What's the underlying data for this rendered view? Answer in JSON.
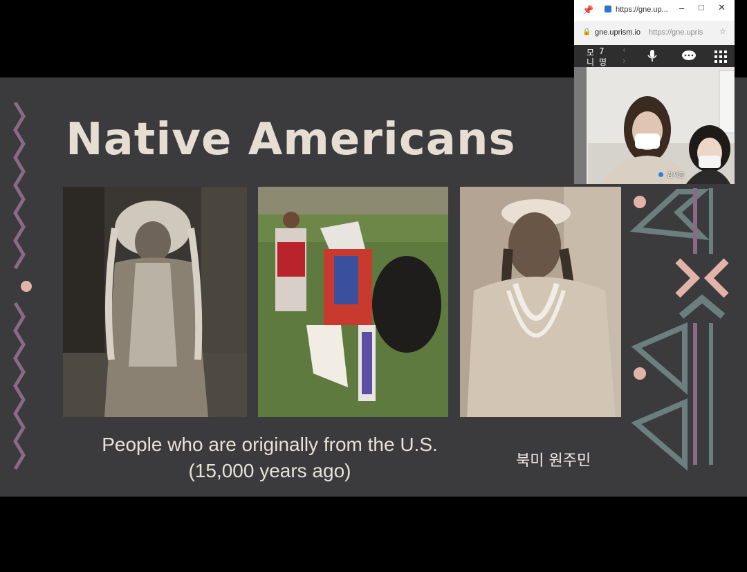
{
  "slide": {
    "title": "Native Americans",
    "caption_line1": "People who are originally from the U.S.",
    "caption_line2": "(15,000 years ago)",
    "handwritten_note": "북미 원주민"
  },
  "browser": {
    "tab_title": "https://gne.up...",
    "address_domain": "gne.uprism.io",
    "address_path": "https://gne.upris",
    "toolbar_char_1": "모",
    "toolbar_char_2": "니",
    "toolbar_count_1": "7",
    "toolbar_count_2": "명",
    "participant_name": "김서영"
  },
  "colors": {
    "slide_bg": "#3b3b3d",
    "title": "#e6ded3",
    "deco_purple": "#8a6a86",
    "deco_pink": "#e2b4a8",
    "deco_teal": "#6b7f7f"
  },
  "icons": [
    "microphone-icon",
    "chat-icon",
    "grid-icon",
    "pin-icon",
    "lock-icon",
    "star-icon",
    "minimize-icon",
    "maximize-icon",
    "close-icon"
  ]
}
